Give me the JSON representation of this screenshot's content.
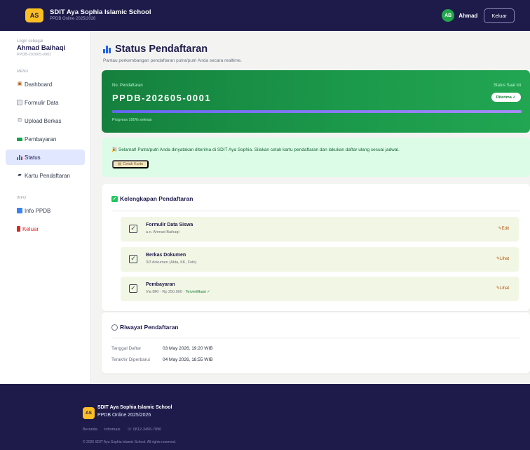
{
  "header": {
    "logo": "AS",
    "school_name": "SDIT Aya Sophia Islamic School",
    "subtitle": "PPDB Online 2025/2026",
    "avatar": "AB",
    "user_name": "Ahmad",
    "logout_label": "Keluar"
  },
  "sidebar": {
    "login_as": "Login sebagai",
    "user_name": "Ahmad Baihaqi",
    "user_id": "PPDB-202605-0001",
    "section_menu": "MENU",
    "section_other": "INFO",
    "items": [
      {
        "label": "Dashboard",
        "icon": "dashboard-icon"
      },
      {
        "label": "Formulir Data",
        "icon": "form-icon"
      },
      {
        "label": "Upload Berkas",
        "icon": "upload-icon"
      },
      {
        "label": "Pembayaran",
        "icon": "payment-icon"
      },
      {
        "label": "Status",
        "icon": "chart-icon"
      },
      {
        "label": "Kartu Pendaftaran",
        "icon": "card-icon"
      }
    ],
    "other_items": [
      {
        "label": "Info PPDB",
        "icon": "info-icon"
      },
      {
        "label": "Keluar",
        "icon": "logout-icon"
      }
    ]
  },
  "main": {
    "title": "Status Pendaftaran",
    "subtitle": "Pantau perkembangan pendaftaran putra/putri Anda secara realtime.",
    "hero": {
      "number_label": "No. Pendaftaran",
      "number": "PPDB-202605-0001",
      "progress_text": "Progress 100% selesai",
      "progress": 1.0,
      "status_label": "Status Saat Ini",
      "status_badge": "Diterima ✓"
    },
    "notice": {
      "message": "Selamat! Putra/putri Anda dinyatakan diterima di SDIT Aya Sophia. Silakan cetak kartu pendaftaran dan lakukan daftar ulang sesuai jadwal.",
      "button": "Cetak Kartu"
    },
    "completeness": {
      "title": "Kelengkapan Pendaftaran",
      "items": [
        {
          "title": "Formulir Data Siswa",
          "sub": "a.n. Ahmad Baihaqi",
          "sub_ok": "",
          "action": "Edit"
        },
        {
          "title": "Berkas Dokumen",
          "sub": "3/3 dokumen (Akta, KK, Foto)",
          "sub_ok": "",
          "action": "Lihat"
        },
        {
          "title": "Pembayaran",
          "sub": "Via BRI · Rp 250.000 · ",
          "sub_ok": "Terverifikasi ✓",
          "action": "Lihat"
        }
      ]
    },
    "history": {
      "title": "Riwayat Pendaftaran",
      "rows": [
        {
          "label": "Tanggal Daftar",
          "value": "03 May 2026, 19:20 WIB"
        },
        {
          "label": "Terakhir Diperbarui",
          "value": "04 May 2026, 18:55 WIB"
        }
      ]
    }
  },
  "footer": {
    "logo": "AS",
    "school_name": "SDIT Aya Sophia Islamic School",
    "subtitle": "PPDB Online 2025/2026",
    "links": [
      "Beranda",
      "Informasi",
      "☏ 0812-3456-7890"
    ],
    "copyright": "© 2026 SDIT Aya Sophia Islamic School. All rights reserved."
  },
  "colors": {
    "navy": "#1e1b4b",
    "green": "#1c9a4b",
    "accent_yellow": "#fbbf24"
  }
}
